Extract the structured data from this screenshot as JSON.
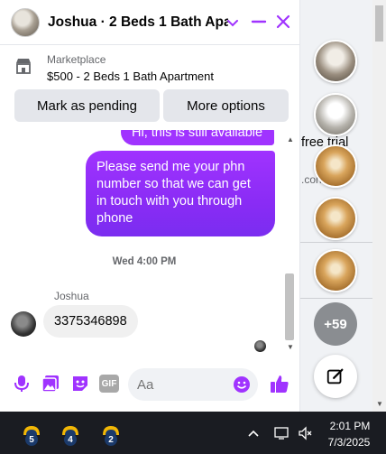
{
  "chat": {
    "title": "Joshua · 2 Beds 1 Bath Apa...",
    "listing_source": "Marketplace",
    "listing_title": "$500 - 2 Beds 1 Bath Apartment",
    "buttons": {
      "pending": "Mark as pending",
      "more": "More options"
    },
    "messages": {
      "outgoing_partial": "Hi, this is still available",
      "outgoing_main": "Please send me your phn number so that we can get in touch with you through phone",
      "time_separator": "Wed 4:00 PM",
      "sender_name": "Joshua",
      "incoming": "3375346898"
    },
    "composer": {
      "placeholder": "Aa"
    },
    "accent_color": "#a033ff"
  },
  "side_panel": {
    "bg_text_1": "free trial",
    "bg_text_2": ".con",
    "more_count": "+59"
  },
  "taskbar": {
    "apps": [
      {
        "icon": "weather-app-icon",
        "badge": "5"
      },
      {
        "icon": "weather-app-icon",
        "badge": "4"
      },
      {
        "icon": "weather-app-icon",
        "badge": "2"
      }
    ],
    "time": "2:01 PM",
    "date": "7/3/2025"
  }
}
